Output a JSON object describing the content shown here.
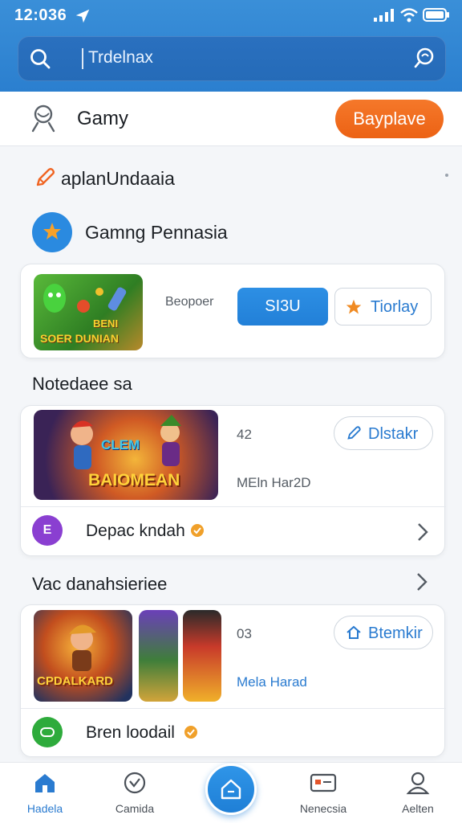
{
  "status_bar": {
    "time": "12:036"
  },
  "search": {
    "value": "Trdelnax"
  },
  "user": {
    "name": "Gamy",
    "play_label": "Bayplave"
  },
  "section1": {
    "title": "aplanUndaaia"
  },
  "section2": {
    "title": "Gamng Pennasia"
  },
  "card1": {
    "thumb_text": [
      "BENI",
      "SOER DUNIAN"
    ],
    "subtitle": "Beopoer",
    "primary_label": "SI3U",
    "secondary_label": "Tiorlay"
  },
  "section3": {
    "title": "Notedaee sa"
  },
  "card2": {
    "thumb_text": [
      "CLEM",
      "BAIOMEAN"
    ],
    "count": "42",
    "action_label": "Dlstakr",
    "meta": "MEln Har2D",
    "row_label": "Depac kndah",
    "row_badge": "E"
  },
  "section4": {
    "title": "Vac danahsieriee"
  },
  "card3": {
    "thumb_text": [
      "CPDALKARD"
    ],
    "count": "03",
    "action_label": "Btemkir",
    "meta": "Mela Harad",
    "row_label": "Bren loodail"
  },
  "bottom_nav": [
    {
      "label": "Hadela"
    },
    {
      "label": "Camida"
    },
    {
      "label": "Nenecsia"
    },
    {
      "label": "Aelten"
    }
  ],
  "colors": {
    "brand_blue": "#2a7bd0",
    "accent_orange": "#ec6214",
    "purple": "#8a3fd1",
    "green": "#2eab3c"
  }
}
